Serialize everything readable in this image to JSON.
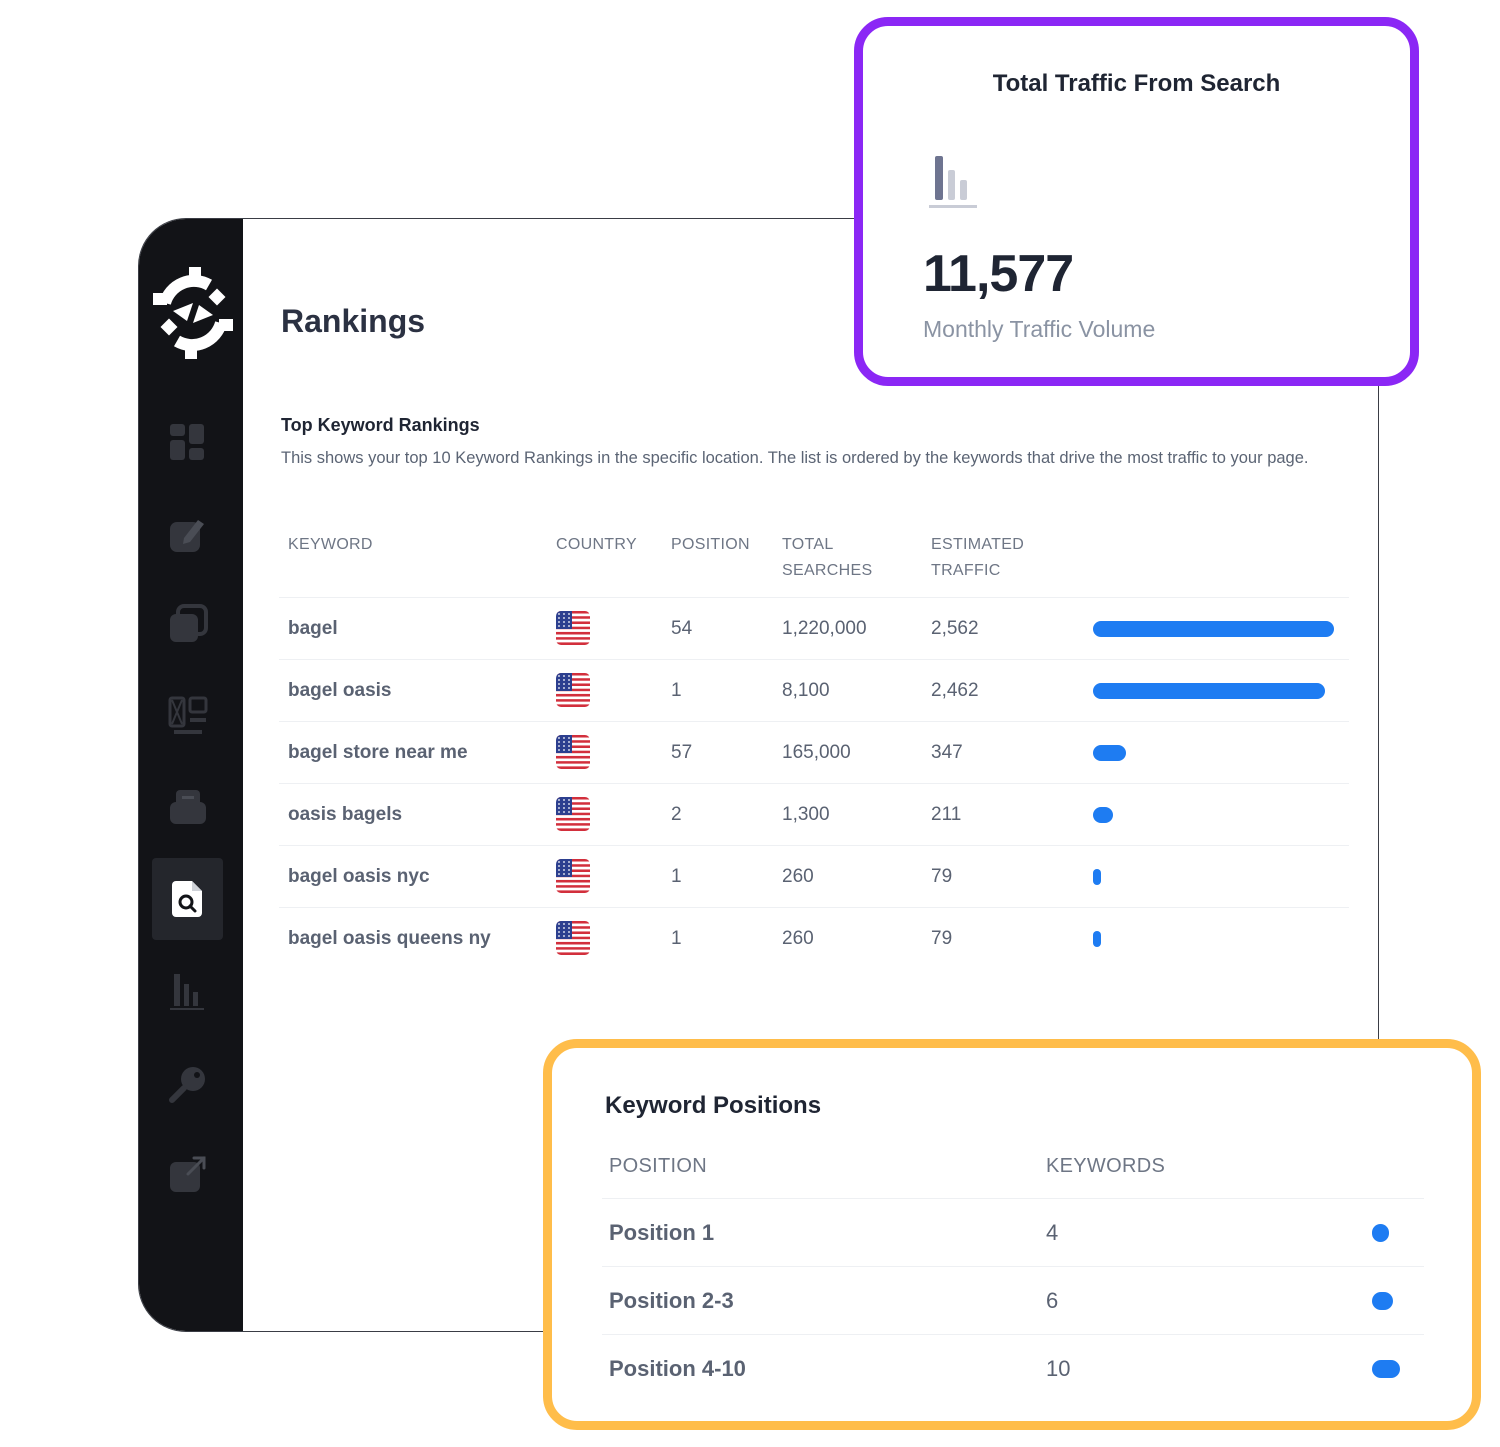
{
  "page": {
    "title": "Rankings",
    "section_title": "Top Keyword Rankings",
    "section_description": "This shows your top 10 Keyword Rankings in the specific location. The list is ordered by the keywords that drive the most traffic to your page."
  },
  "sidebar": {
    "items": [
      {
        "icon": "dashboard-icon"
      },
      {
        "icon": "edit-icon"
      },
      {
        "icon": "pages-icon"
      },
      {
        "icon": "layout-icon"
      },
      {
        "icon": "inbox-icon"
      },
      {
        "icon": "search-document-icon",
        "active": true
      },
      {
        "icon": "bar-chart-icon"
      },
      {
        "icon": "key-icon"
      },
      {
        "icon": "external-link-icon"
      }
    ]
  },
  "table": {
    "headers": {
      "keyword": "KEYWORD",
      "country": "COUNTRY",
      "position": "POSITION",
      "total_searches_1": "TOTAL",
      "total_searches_2": "SEARCHES",
      "estimated_traffic_1": "ESTIMATED",
      "estimated_traffic_2": "TRAFFIC"
    },
    "rows": [
      {
        "keyword": "bagel",
        "country": "US",
        "position": "54",
        "searches": "1,220,000",
        "traffic": "2,562",
        "traffic_value": 2562
      },
      {
        "keyword": "bagel oasis",
        "country": "US",
        "position": "1",
        "searches": "8,100",
        "traffic": "2,462",
        "traffic_value": 2462
      },
      {
        "keyword": "bagel store near me",
        "country": "US",
        "position": "57",
        "searches": "165,000",
        "traffic": "347",
        "traffic_value": 347
      },
      {
        "keyword": "oasis bagels",
        "country": "US",
        "position": "2",
        "searches": "1,300",
        "traffic": "211",
        "traffic_value": 211
      },
      {
        "keyword": "bagel oasis nyc",
        "country": "US",
        "position": "1",
        "searches": "260",
        "traffic": "79",
        "traffic_value": 79
      },
      {
        "keyword": "bagel oasis queens ny",
        "country": "US",
        "position": "1",
        "searches": "260",
        "traffic": "79",
        "traffic_value": 79
      }
    ]
  },
  "traffic_card": {
    "title": "Total Traffic From Search",
    "value": "11,577",
    "label": "Monthly Traffic Volume",
    "border_color": "#8b27f5"
  },
  "positions_card": {
    "title": "Keyword Positions",
    "headers": {
      "position": "POSITION",
      "keywords": "KEYWORDS"
    },
    "rows": [
      {
        "label": "Position 1",
        "keywords": "4",
        "value": 4
      },
      {
        "label": "Position 2-3",
        "keywords": "6",
        "value": 6
      },
      {
        "label": "Position 4-10",
        "keywords": "10",
        "value": 10
      }
    ],
    "border_color": "#ffbd4a"
  },
  "colors": {
    "accent_blue": "#1e7cf2",
    "sidebar_bg": "#121317"
  }
}
